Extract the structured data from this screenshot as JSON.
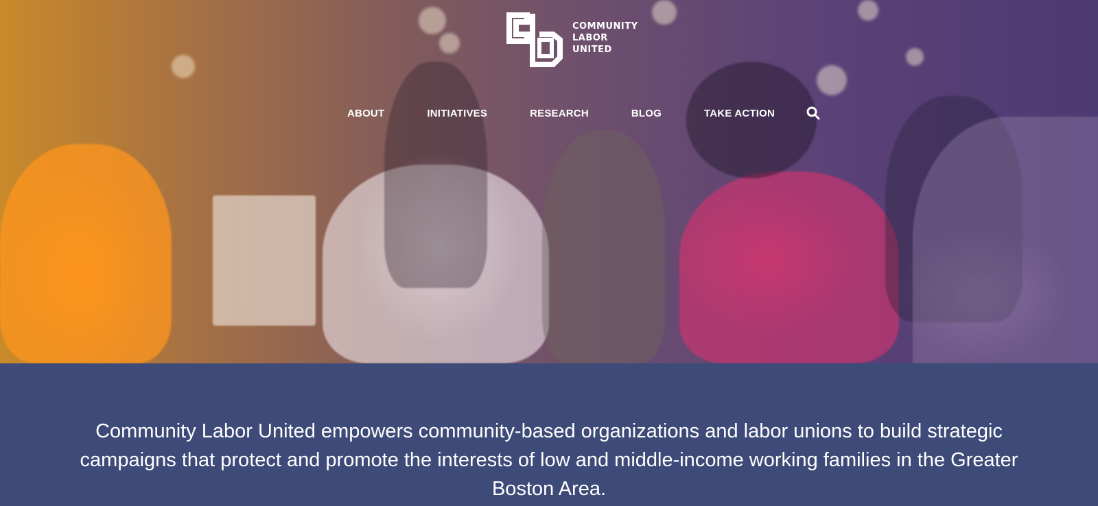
{
  "brand": {
    "logo_lines": [
      "COMMUNITY",
      "LABOR",
      "UNITED"
    ],
    "logo_icon": "clu-logo-icon"
  },
  "nav": {
    "items": [
      {
        "label": "ABOUT"
      },
      {
        "label": "INITIATIVES"
      },
      {
        "label": "RESEARCH"
      },
      {
        "label": "BLOG"
      },
      {
        "label": "TAKE ACTION"
      }
    ],
    "search_icon": "search-icon"
  },
  "hero": {
    "image": "protest-march-photo"
  },
  "mission": {
    "text": "Community Labor United empowers community-based organizations and labor unions to build strategic campaigns that protect and promote the interests of low and middle-income working families in the Greater Boston Area."
  },
  "colors": {
    "mission_bg": "#3e4a78",
    "overlay_left": "#c98a2a",
    "overlay_right": "#4c3a72"
  }
}
